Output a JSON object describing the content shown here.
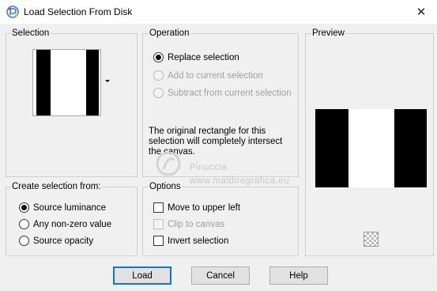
{
  "window": {
    "title": "Load Selection From Disk"
  },
  "selection_group": {
    "label": "Selection"
  },
  "operation": {
    "label": "Operation",
    "options": [
      {
        "label": "Replace selection",
        "selected": true,
        "enabled": true
      },
      {
        "label": "Add to current selection",
        "selected": false,
        "enabled": false
      },
      {
        "label": "Subtract from current selection",
        "selected": false,
        "enabled": false
      }
    ],
    "info": "The original rectangle for this\nselection will completely intersect\nthe canvas."
  },
  "preview": {
    "label": "Preview"
  },
  "create_from": {
    "label": "Create selection from:",
    "options": [
      {
        "label": "Source luminance",
        "selected": true
      },
      {
        "label": "Any non-zero value",
        "selected": false
      },
      {
        "label": "Source opacity",
        "selected": false
      }
    ]
  },
  "options": {
    "label": "Options",
    "items": [
      {
        "label": "Move to upper left",
        "checked": false,
        "enabled": true
      },
      {
        "label": "Clip to canvas",
        "checked": false,
        "enabled": false
      },
      {
        "label": "Invert selection",
        "checked": false,
        "enabled": true
      }
    ]
  },
  "buttons": {
    "load": "Load",
    "cancel": "Cancel",
    "help": "Help"
  },
  "watermark": {
    "line1": "Pinuccia",
    "line2": "www.maldiregrafica.eu"
  },
  "colors": {
    "accent": "#0078d7",
    "button_face": "#e1e1e1",
    "dialog_bg": "#f0f0f0"
  },
  "icons": {
    "app": "paint-app-icon",
    "close": "close-icon",
    "transparency": "checkerboard-icon"
  }
}
